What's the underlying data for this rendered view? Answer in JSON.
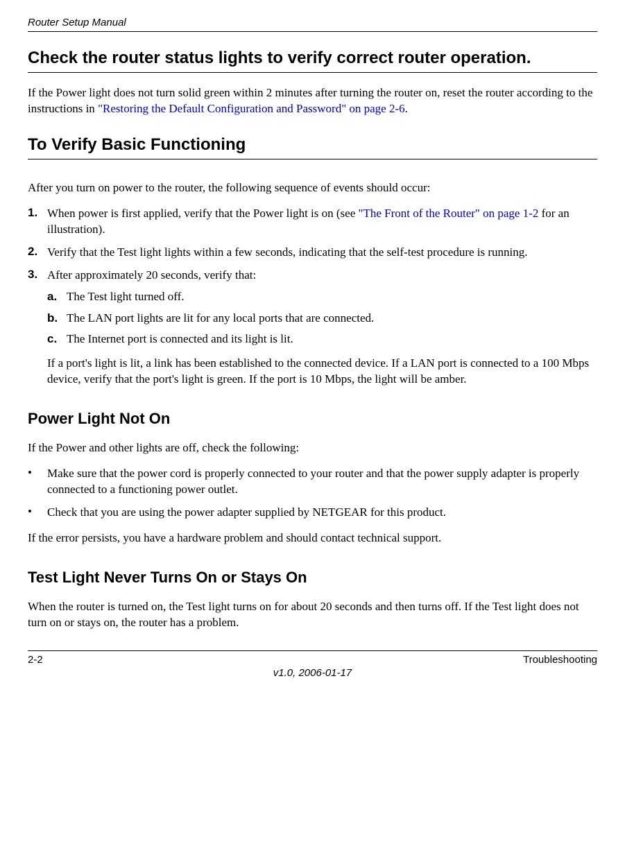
{
  "header": {
    "title": "Router Setup Manual"
  },
  "h_status": "Check the router status lights to verify correct router operation.",
  "p_status_1a": "If the Power light does not turn solid green within 2 minutes after turning the router on, reset the router according to the instructions in ",
  "p_status_1link": "\"Restoring the Default Configuration and Password\" on page 2-6",
  "p_status_1b": ".",
  "h_verify": "To Verify Basic Functioning",
  "p_verify_intro": "After you turn on power to the router, the following sequence of events should occur:",
  "steps": [
    {
      "n": "1.",
      "text_a": "When power is first applied, verify that the Power light is on (see ",
      "link": "\"The Front of the Router\" on page 1-2",
      "text_b": " for an illustration)."
    },
    {
      "n": "2.",
      "text": "Verify that the Test light lights within a few seconds, indicating that the self-test procedure is running."
    },
    {
      "n": "3.",
      "text": "After approximately 20 seconds, verify that:"
    }
  ],
  "substeps": [
    {
      "m": "a.",
      "text": "The Test light turned off."
    },
    {
      "m": "b.",
      "text": "The LAN port lights are lit for any local ports that are connected."
    },
    {
      "m": "c.",
      "text": "The Internet port is connected and its light is lit."
    }
  ],
  "p_after_sub": "If a port's light is lit, a link has been established to the connected device. If a LAN port is connected to a 100 Mbps device, verify that the port's light is green. If the port is 10 Mbps, the light will be amber.",
  "h_power": "Power Light Not On",
  "p_power_intro": "If the Power and other lights are off, check the following:",
  "bullets": [
    "Make sure that the power cord is properly connected to your router and that the power supply adapter is properly connected to a functioning power outlet.",
    "Check that you are using the power adapter supplied by NETGEAR for this product."
  ],
  "p_power_tail": "If the error persists, you have a hardware problem and should contact technical support.",
  "h_test": "Test Light Never Turns On or Stays On",
  "p_test": "When the router is turned on, the Test light turns on for about 20 seconds and then turns off. If the Test light does not turn on or stays on, the router has a problem.",
  "footer": {
    "pagenum": "2-2",
    "section": "Troubleshooting",
    "version": "v1.0, 2006-01-17"
  }
}
